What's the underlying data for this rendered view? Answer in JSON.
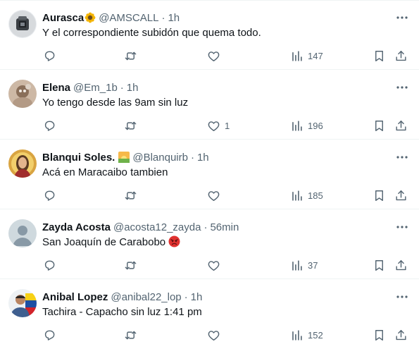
{
  "tweets": [
    {
      "name": "Aurasca",
      "name_emoji": "sunflower",
      "handle": "@AMSCALL",
      "time": "1h",
      "text": "Y el correspondiente subidón que quema todo.",
      "replies": "",
      "retweets": "",
      "likes": "",
      "views": "147"
    },
    {
      "name": "Elena",
      "name_emoji": "",
      "handle": "@Em_1b",
      "time": "1h",
      "text": "Yo tengo desde las 9am sin luz",
      "replies": "",
      "retweets": "",
      "likes": "1",
      "views": "196"
    },
    {
      "name": "Blanqui Soles.",
      "name_emoji": "sunrise",
      "handle": "@Blanquirb",
      "time": "1h",
      "text": "Acá en Maracaibo tambien",
      "replies": "",
      "retweets": "",
      "likes": "",
      "views": "185"
    },
    {
      "name": "Zayda Acosta",
      "name_emoji": "",
      "handle": "@acosta12_zayda",
      "time": "56min",
      "text": "San Joaquín de Carabobo",
      "text_emoji": "angry-face",
      "replies": "",
      "retweets": "",
      "likes": "",
      "views": "37"
    },
    {
      "name": "Anibal Lopez",
      "name_emoji": "",
      "handle": "@anibal22_lop",
      "time": "1h",
      "text": "Tachira - Capacho sin luz 1:41 pm",
      "replies": "",
      "retweets": "",
      "likes": "",
      "views": "152"
    }
  ],
  "separator": "·",
  "icons": {
    "more": "more-dots-icon",
    "reply": "reply-icon",
    "retweet": "retweet-icon",
    "like": "heart-icon",
    "views": "views-bar-chart-icon",
    "bookmark": "bookmark-icon",
    "share": "share-icon"
  },
  "colors": {
    "text": "#0f1419",
    "secondary": "#536471",
    "divider": "#eff3f4"
  }
}
